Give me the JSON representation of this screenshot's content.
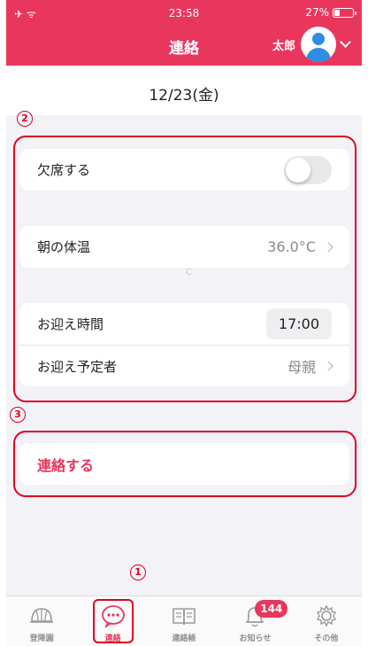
{
  "status_bar": {
    "left": "✈ ᯤ",
    "time": "23:58",
    "battery": "27%"
  },
  "header": {
    "title": "連絡",
    "user_name": "太郎"
  },
  "date": "12/23(金)",
  "absence": {
    "label": "欠席する",
    "enabled": false
  },
  "temperature": {
    "label": "朝の体温",
    "value": "36.0°C"
  },
  "pickup": {
    "time_label": "お迎え時間",
    "time_value": "17:00",
    "person_label": "お迎え予定者",
    "person_value": "母親"
  },
  "faint_mark": "C",
  "action_label": "連絡する",
  "annotations": {
    "one": "1",
    "two": "2",
    "three": "3"
  },
  "tabs": [
    {
      "label": "登降園",
      "icon": "helmet-icon"
    },
    {
      "label": "連絡",
      "icon": "chat-bubble-icon",
      "active": true
    },
    {
      "label": "連絡帳",
      "icon": "book-icon"
    },
    {
      "label": "お知らせ",
      "icon": "bell-icon",
      "badge": "144"
    },
    {
      "label": "その他",
      "icon": "gear-icon"
    }
  ],
  "colors": {
    "brand": "#e8365d",
    "annotation": "#e00022",
    "background": "#f2f2f7"
  }
}
